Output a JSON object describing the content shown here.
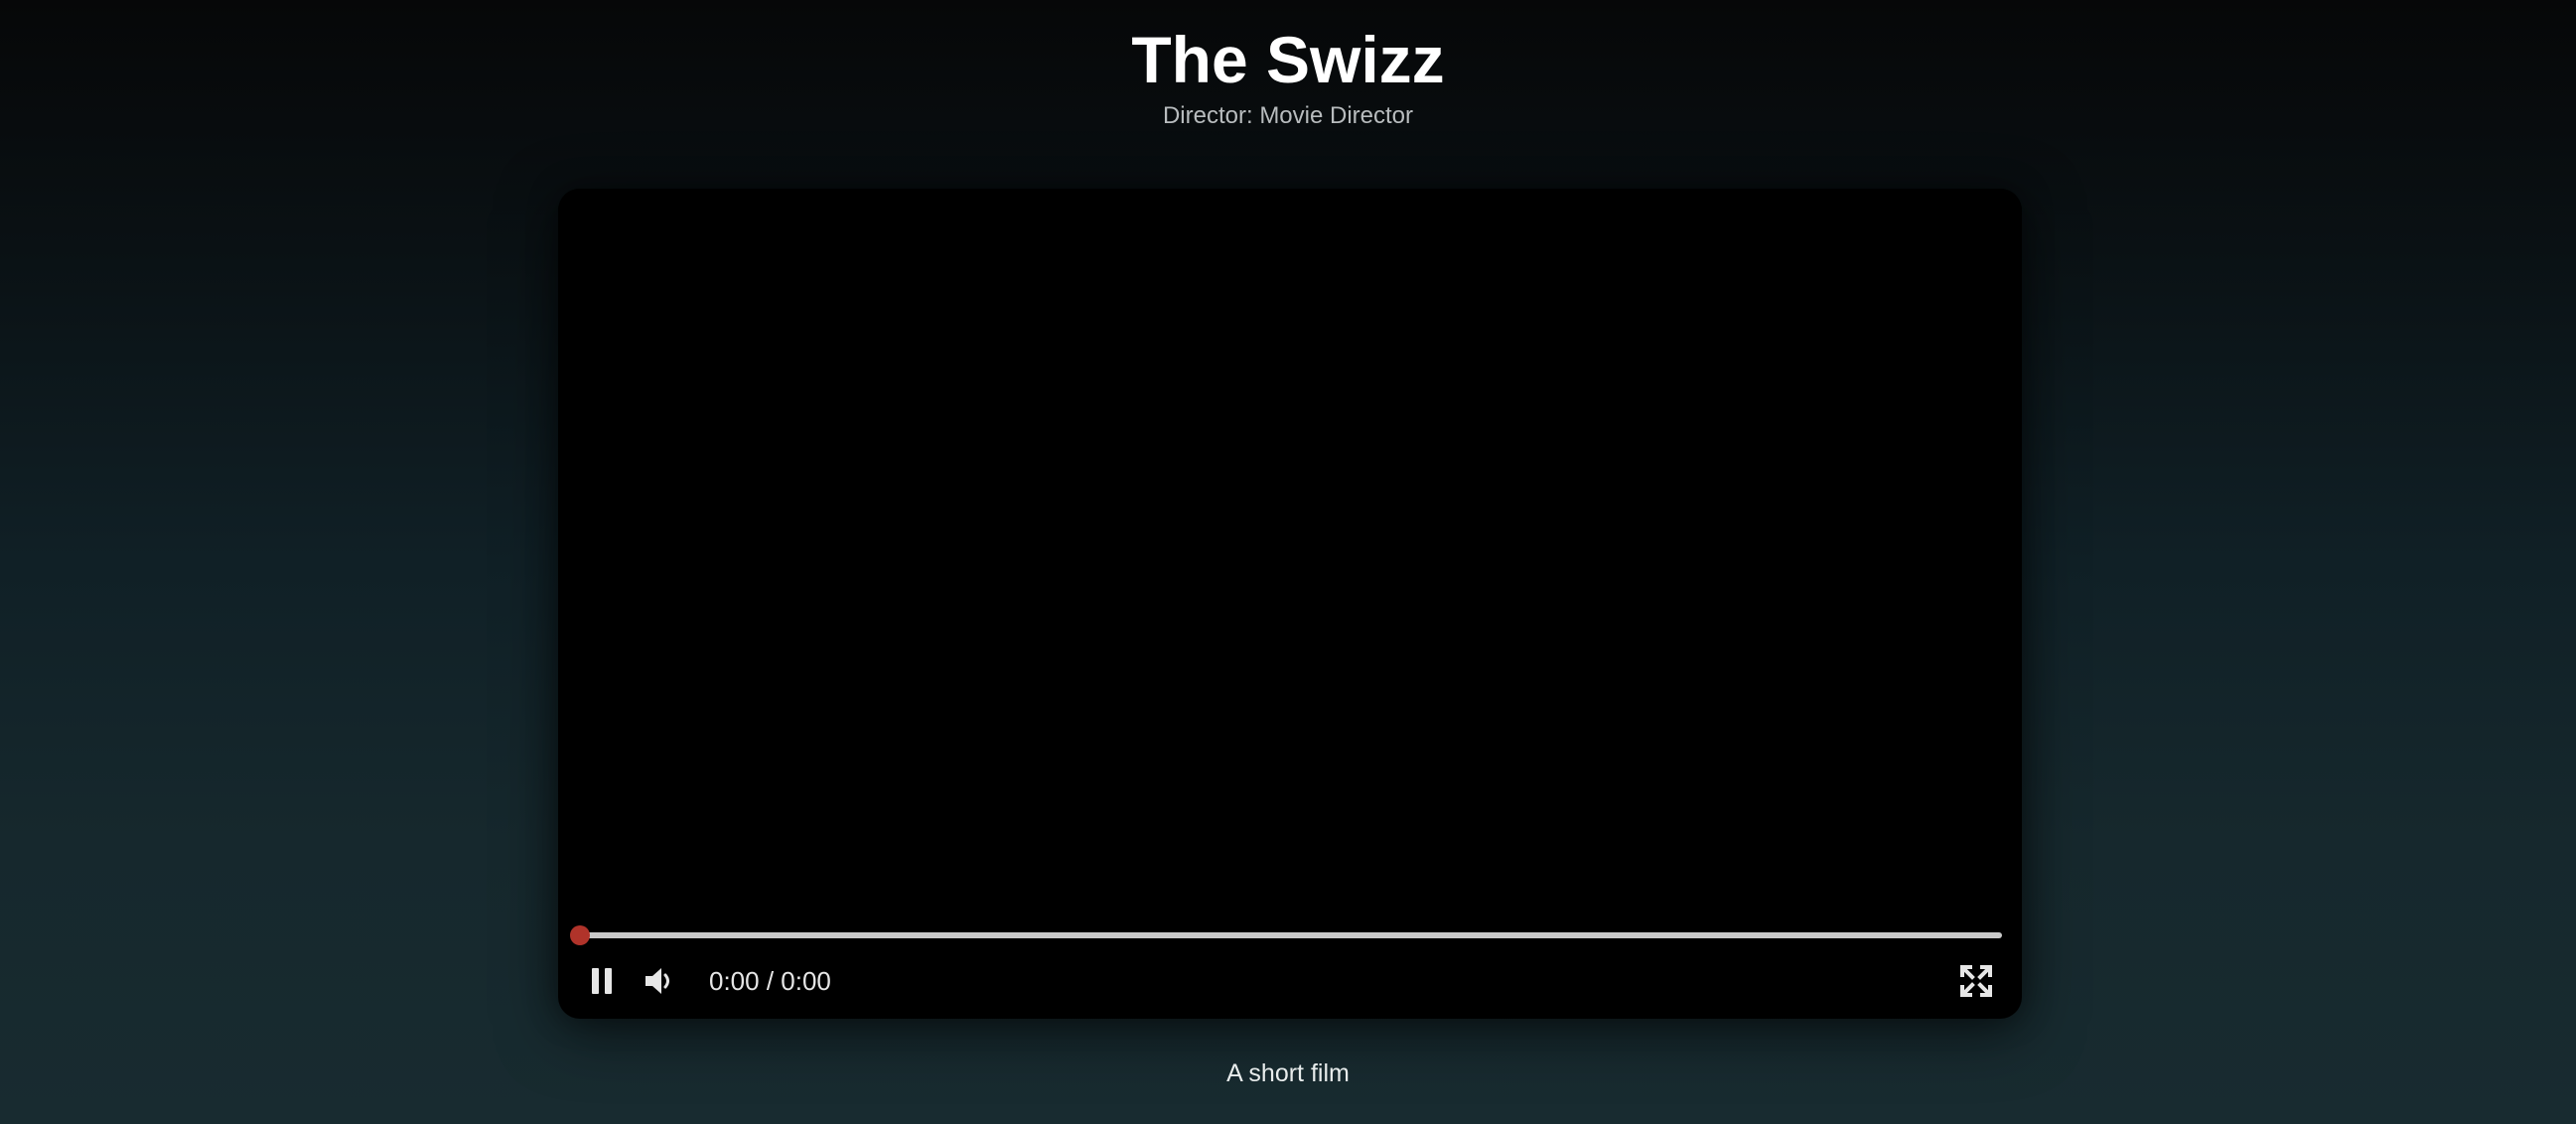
{
  "movie": {
    "title": "The Swizz",
    "director_line": "Director: Movie Director",
    "caption": "A short film"
  },
  "player": {
    "current_time": "0:00",
    "duration": "0:00",
    "time_display": "0:00 / 0:00",
    "progress_fraction": 0,
    "state": "playing",
    "controls": {
      "pause_icon": "pause-icon",
      "volume_icon": "volume-icon",
      "fullscreen_icon": "fullscreen-icon"
    }
  },
  "colors": {
    "accent": "#c0392b",
    "track": "#c9c9c9",
    "video_background": "#000000"
  }
}
